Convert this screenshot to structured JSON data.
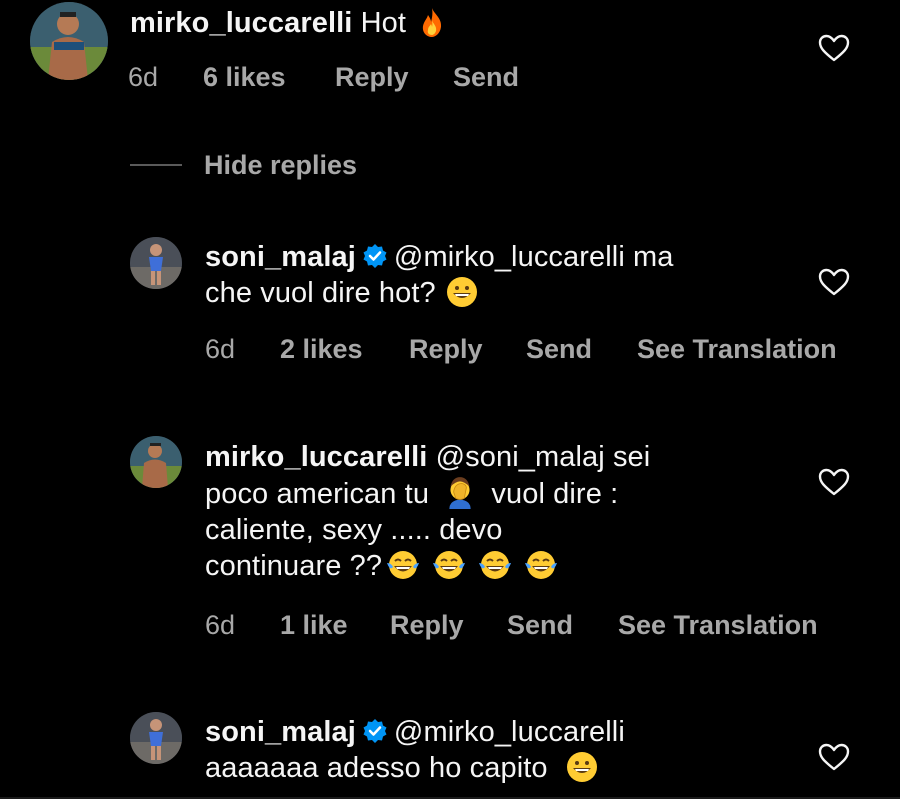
{
  "comments": [
    {
      "username": "mirko_luccarelli",
      "text": "Hot",
      "time": "6d",
      "likes": "6 likes",
      "reply": "Reply",
      "send": "Send"
    },
    {
      "username": "soni_malaj",
      "text_line1": "@mirko_luccarelli ma",
      "text_line2": "che vuol dire hot?",
      "time": "6d",
      "likes": "2 likes",
      "reply": "Reply",
      "send": "Send",
      "translate": "See Translation"
    },
    {
      "username": "mirko_luccarelli",
      "text_line1": "@soni_malaj sei",
      "text_line2a": "poco american tu",
      "text_line2b": "vuol dire :",
      "text_line3": "caliente,  sexy ..... devo",
      "text_line4": "continuare ??",
      "time": "6d",
      "likes": "1 like",
      "reply": "Reply",
      "send": "Send",
      "translate": "See Translation"
    },
    {
      "username": "soni_malaj",
      "text_line1": "@mirko_luccarelli",
      "text_line2": "aaaaaaa adesso ho capito"
    }
  ],
  "thread": {
    "hide_replies": "Hide replies"
  },
  "colors": {
    "background": "#000000",
    "text": "#f5f5f5",
    "muted": "#a8a8a8",
    "verified": "#0095f6"
  },
  "icons": [
    "heart-icon",
    "verified-badge-icon",
    "fire-emoji",
    "grinning-emoji",
    "facepalm-emoji",
    "tears-of-joy-emoji"
  ]
}
